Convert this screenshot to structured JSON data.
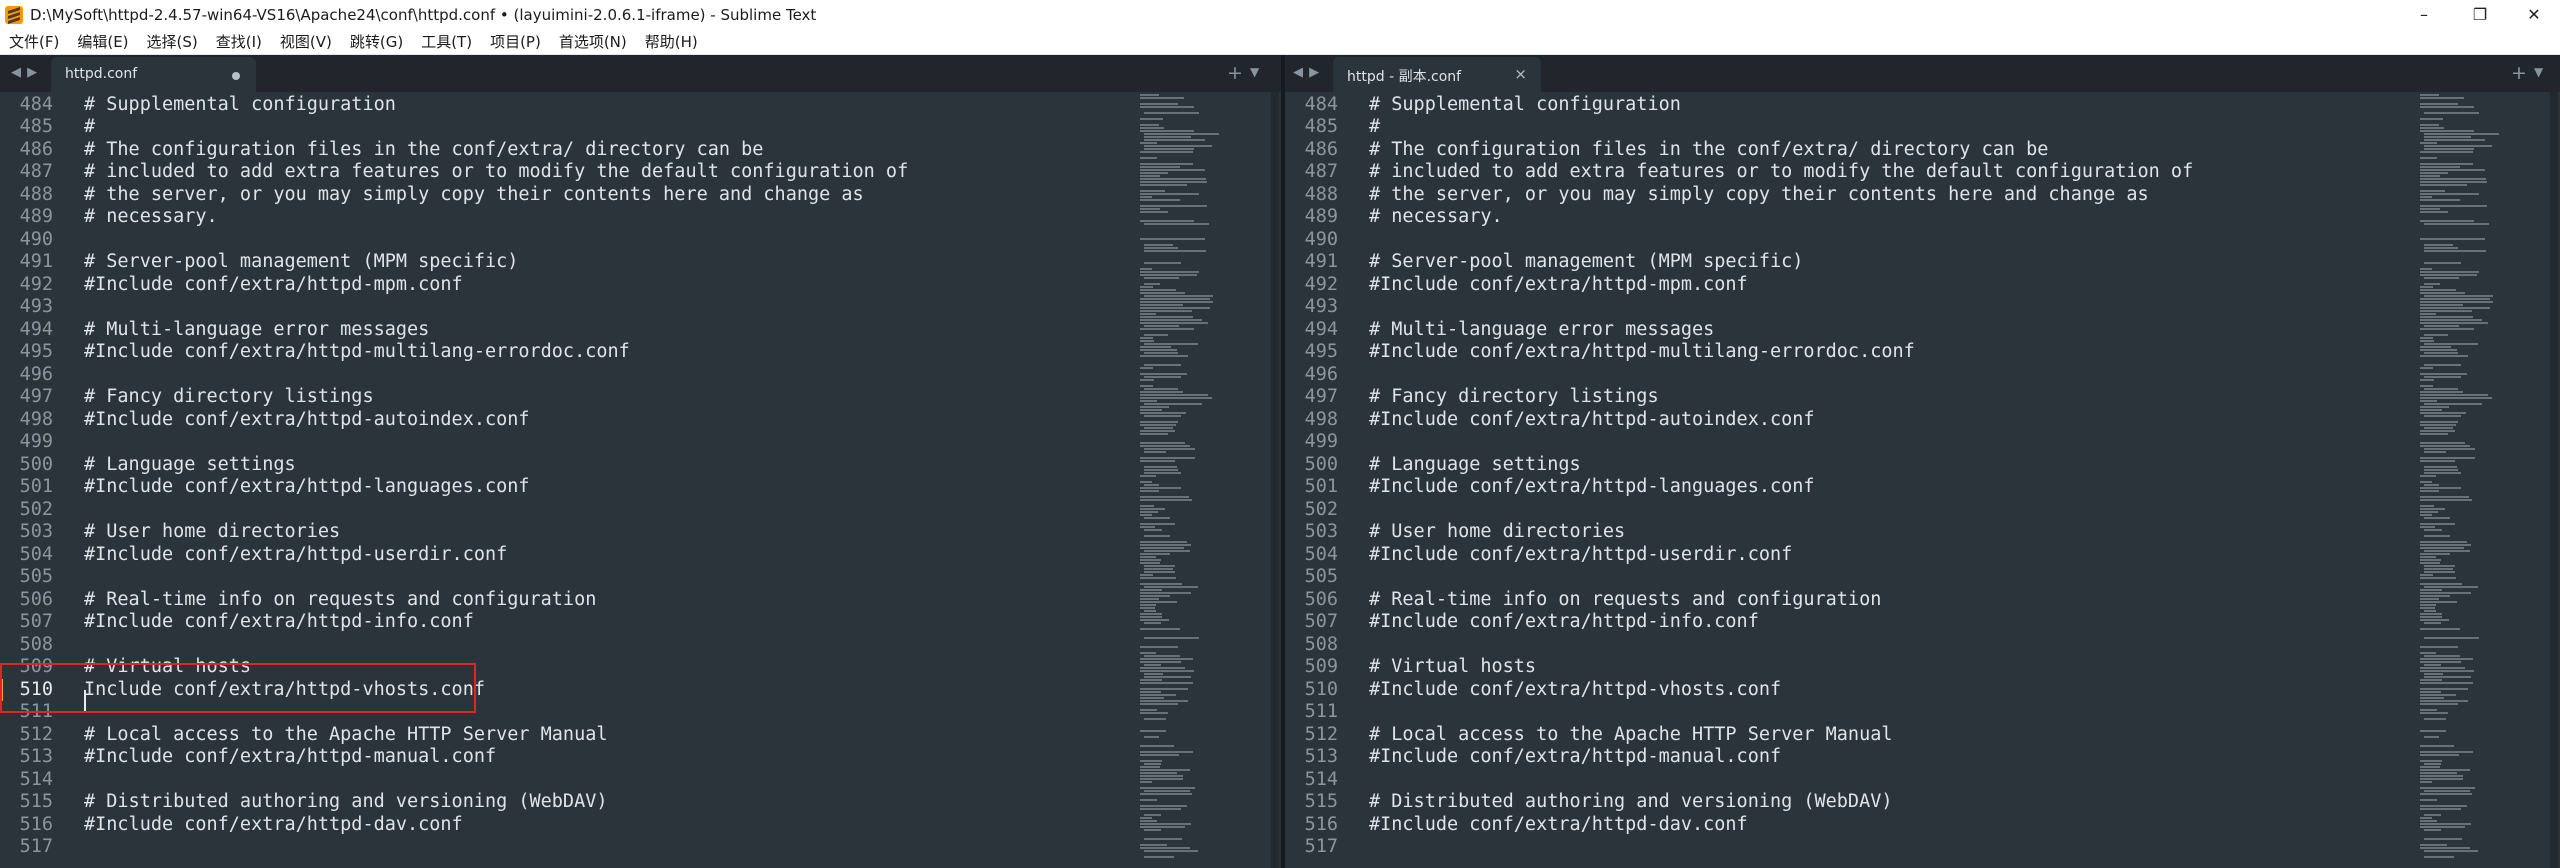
{
  "window": {
    "title": "D:\\MySoft\\httpd-2.4.57-win64-VS16\\Apache24\\conf\\httpd.conf • (layuimini-2.0.6.1-iframe) - Sublime Text",
    "controls": [
      "–",
      "❐",
      "✕"
    ]
  },
  "menu": [
    "文件(F)",
    "编辑(E)",
    "选择(S)",
    "查找(I)",
    "视图(V)",
    "跳转(G)",
    "工具(T)",
    "项目(P)",
    "首选项(N)",
    "帮助(H)"
  ],
  "left_pane": {
    "tab_label": "httpd.conf",
    "tab_modified": true,
    "active_line": "510",
    "lines": [
      {
        "n": "484",
        "t": "# Supplemental configuration"
      },
      {
        "n": "485",
        "t": "#"
      },
      {
        "n": "486",
        "t": "# The configuration files in the conf/extra/ directory can be"
      },
      {
        "n": "487",
        "t": "# included to add extra features or to modify the default configuration of"
      },
      {
        "n": "488",
        "t": "# the server, or you may simply copy their contents here and change as"
      },
      {
        "n": "489",
        "t": "# necessary."
      },
      {
        "n": "490",
        "t": ""
      },
      {
        "n": "491",
        "t": "# Server-pool management (MPM specific)"
      },
      {
        "n": "492",
        "t": "#Include conf/extra/httpd-mpm.conf"
      },
      {
        "n": "493",
        "t": ""
      },
      {
        "n": "494",
        "t": "# Multi-language error messages"
      },
      {
        "n": "495",
        "t": "#Include conf/extra/httpd-multilang-errordoc.conf"
      },
      {
        "n": "496",
        "t": ""
      },
      {
        "n": "497",
        "t": "# Fancy directory listings"
      },
      {
        "n": "498",
        "t": "#Include conf/extra/httpd-autoindex.conf"
      },
      {
        "n": "499",
        "t": ""
      },
      {
        "n": "500",
        "t": "# Language settings"
      },
      {
        "n": "501",
        "t": "#Include conf/extra/httpd-languages.conf"
      },
      {
        "n": "502",
        "t": ""
      },
      {
        "n": "503",
        "t": "# User home directories"
      },
      {
        "n": "504",
        "t": "#Include conf/extra/httpd-userdir.conf"
      },
      {
        "n": "505",
        "t": ""
      },
      {
        "n": "506",
        "t": "# Real-time info on requests and configuration"
      },
      {
        "n": "507",
        "t": "#Include conf/extra/httpd-info.conf"
      },
      {
        "n": "508",
        "t": ""
      },
      {
        "n": "509",
        "t": "# Virtual hosts"
      },
      {
        "n": "510",
        "t": "Include conf/extra/httpd-vhosts.conf"
      },
      {
        "n": "511",
        "t": ""
      },
      {
        "n": "512",
        "t": "# Local access to the Apache HTTP Server Manual"
      },
      {
        "n": "513",
        "t": "#Include conf/extra/httpd-manual.conf"
      },
      {
        "n": "514",
        "t": ""
      },
      {
        "n": "515",
        "t": "# Distributed authoring and versioning (WebDAV)"
      },
      {
        "n": "516",
        "t": "#Include conf/extra/httpd-dav.conf"
      },
      {
        "n": "517",
        "t": ""
      }
    ]
  },
  "right_pane": {
    "tab_label": "httpd - 副本.conf",
    "tab_modified": false,
    "lines": [
      {
        "n": "484",
        "t": "# Supplemental configuration"
      },
      {
        "n": "485",
        "t": "#"
      },
      {
        "n": "486",
        "t": "# The configuration files in the conf/extra/ directory can be"
      },
      {
        "n": "487",
        "t": "# included to add extra features or to modify the default configuration of"
      },
      {
        "n": "488",
        "t": "# the server, or you may simply copy their contents here and change as"
      },
      {
        "n": "489",
        "t": "# necessary."
      },
      {
        "n": "490",
        "t": ""
      },
      {
        "n": "491",
        "t": "# Server-pool management (MPM specific)"
      },
      {
        "n": "492",
        "t": "#Include conf/extra/httpd-mpm.conf"
      },
      {
        "n": "493",
        "t": ""
      },
      {
        "n": "494",
        "t": "# Multi-language error messages"
      },
      {
        "n": "495",
        "t": "#Include conf/extra/httpd-multilang-errordoc.conf"
      },
      {
        "n": "496",
        "t": ""
      },
      {
        "n": "497",
        "t": "# Fancy directory listings"
      },
      {
        "n": "498",
        "t": "#Include conf/extra/httpd-autoindex.conf"
      },
      {
        "n": "499",
        "t": ""
      },
      {
        "n": "500",
        "t": "# Language settings"
      },
      {
        "n": "501",
        "t": "#Include conf/extra/httpd-languages.conf"
      },
      {
        "n": "502",
        "t": ""
      },
      {
        "n": "503",
        "t": "# User home directories"
      },
      {
        "n": "504",
        "t": "#Include conf/extra/httpd-userdir.conf"
      },
      {
        "n": "505",
        "t": ""
      },
      {
        "n": "506",
        "t": "# Real-time info on requests and configuration"
      },
      {
        "n": "507",
        "t": "#Include conf/extra/httpd-info.conf"
      },
      {
        "n": "508",
        "t": ""
      },
      {
        "n": "509",
        "t": "# Virtual hosts"
      },
      {
        "n": "510",
        "t": "#Include conf/extra/httpd-vhosts.conf"
      },
      {
        "n": "511",
        "t": ""
      },
      {
        "n": "512",
        "t": "# Local access to the Apache HTTP Server Manual"
      },
      {
        "n": "513",
        "t": "#Include conf/extra/httpd-manual.conf"
      },
      {
        "n": "514",
        "t": ""
      },
      {
        "n": "515",
        "t": "# Distributed authoring and versioning (WebDAV)"
      },
      {
        "n": "516",
        "t": "#Include conf/extra/httpd-dav.conf"
      },
      {
        "n": "517",
        "t": ""
      }
    ]
  },
  "icons": {
    "tab_nav": "◀ ▶",
    "new_tab": "+",
    "tab_menu": "▼",
    "tab_close": "×"
  },
  "colors": {
    "editor_bg": "#2b333b",
    "tabbar_bg": "#20262b",
    "highlight_border": "#e02525",
    "app_icon": "#ff9800"
  }
}
